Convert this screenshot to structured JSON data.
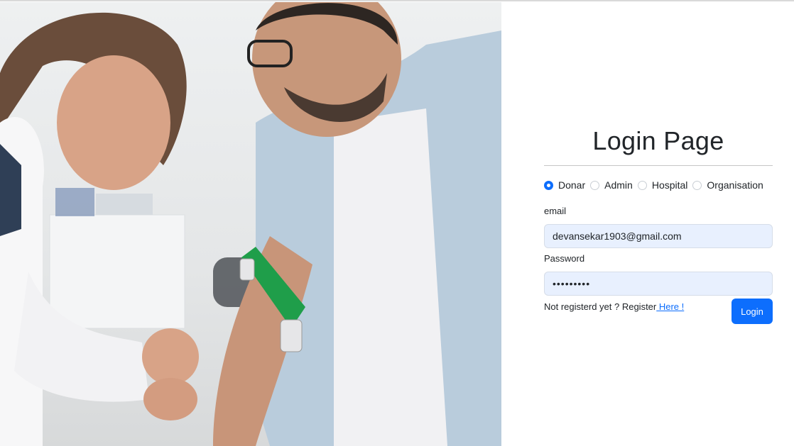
{
  "photo": {
    "alt_subject": "nurse-drawing-blood-photo"
  },
  "login": {
    "title": "Login Page",
    "roles": [
      {
        "label": "Donar",
        "checked": true
      },
      {
        "label": "Admin",
        "checked": false
      },
      {
        "label": "Hospital",
        "checked": false
      },
      {
        "label": "Organisation",
        "checked": false
      }
    ],
    "email_label": "email",
    "email_value": "devansekar1903@gmail.com",
    "password_label": "Password",
    "password_value": "•••••••••",
    "register_text": "Not registerd yet ? Register",
    "register_link": " Here !",
    "login_button": "Login"
  },
  "colors": {
    "accent": "#0d6efd",
    "input_bg": "#e8f0fe"
  }
}
